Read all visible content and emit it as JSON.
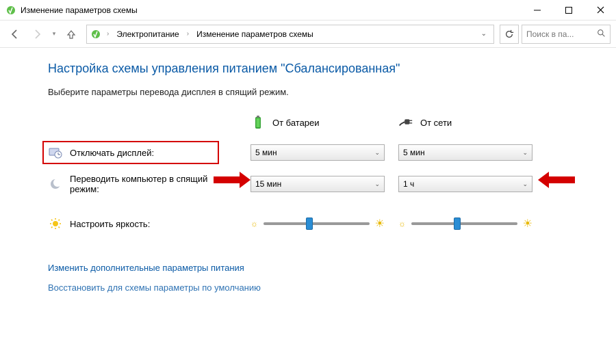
{
  "window": {
    "title": "Изменение параметров схемы"
  },
  "breadcrumb": {
    "item1": "Электропитание",
    "item2": "Изменение параметров схемы"
  },
  "search": {
    "placeholder": "Поиск в па..."
  },
  "page": {
    "heading": "Настройка схемы управления питанием \"Сбалансированная\"",
    "subtext": "Выберите параметры перевода дисплея в спящий режим."
  },
  "columns": {
    "battery": "От батареи",
    "plugged": "От сети"
  },
  "rows": {
    "display_off": {
      "label": "Отключать дисплей:",
      "battery_value": "5 мин",
      "plugged_value": "5 мин"
    },
    "sleep": {
      "label": "Переводить компьютер в спящий режим:",
      "battery_value": "15 мин",
      "plugged_value": "1 ч"
    },
    "brightness": {
      "label": "Настроить яркость:"
    }
  },
  "links": {
    "advanced": "Изменить дополнительные параметры питания",
    "restore": "Восстановить для схемы параметры по умолчанию"
  },
  "brightness_slider": {
    "battery_pos_percent": 40,
    "plugged_pos_percent": 40
  }
}
